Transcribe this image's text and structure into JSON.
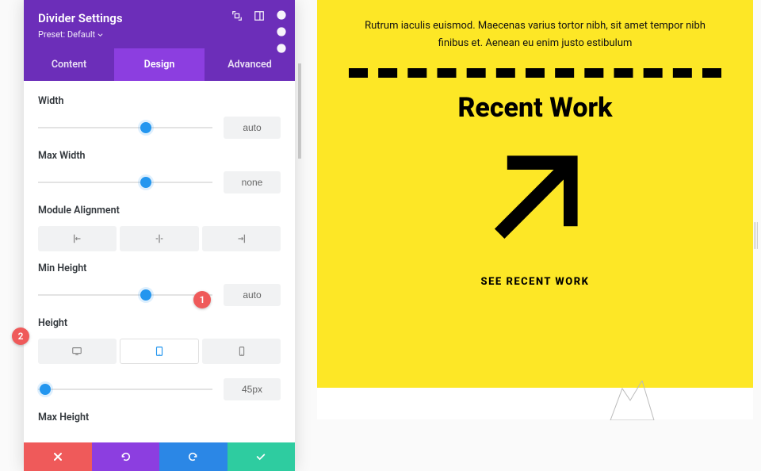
{
  "panel": {
    "title": "Divider Settings",
    "preset_label": "Preset: Default",
    "tabs": {
      "content": "Content",
      "design": "Design",
      "advanced": "Advanced",
      "active": "design"
    },
    "fields": {
      "width": {
        "label": "Width",
        "value": "auto",
        "thumb_pct": 62
      },
      "max_width": {
        "label": "Max Width",
        "value": "none",
        "thumb_pct": 62
      },
      "alignment": {
        "label": "Module Alignment"
      },
      "min_height": {
        "label": "Min Height",
        "value": "auto",
        "thumb_pct": 62
      },
      "height": {
        "label": "Height",
        "value": "45px",
        "thumb_pct": 4
      },
      "max_height": {
        "label": "Max Height"
      }
    }
  },
  "markers": {
    "one": "1",
    "two": "2"
  },
  "preview": {
    "paragraph": "Rutrum iaculis euismod. Maecenas varius tortor nibh, sit amet tempor nibh finibus et. Aenean eu enim justo estibulum",
    "heading": "Recent Work",
    "cta": "SEE RECENT WORK"
  }
}
